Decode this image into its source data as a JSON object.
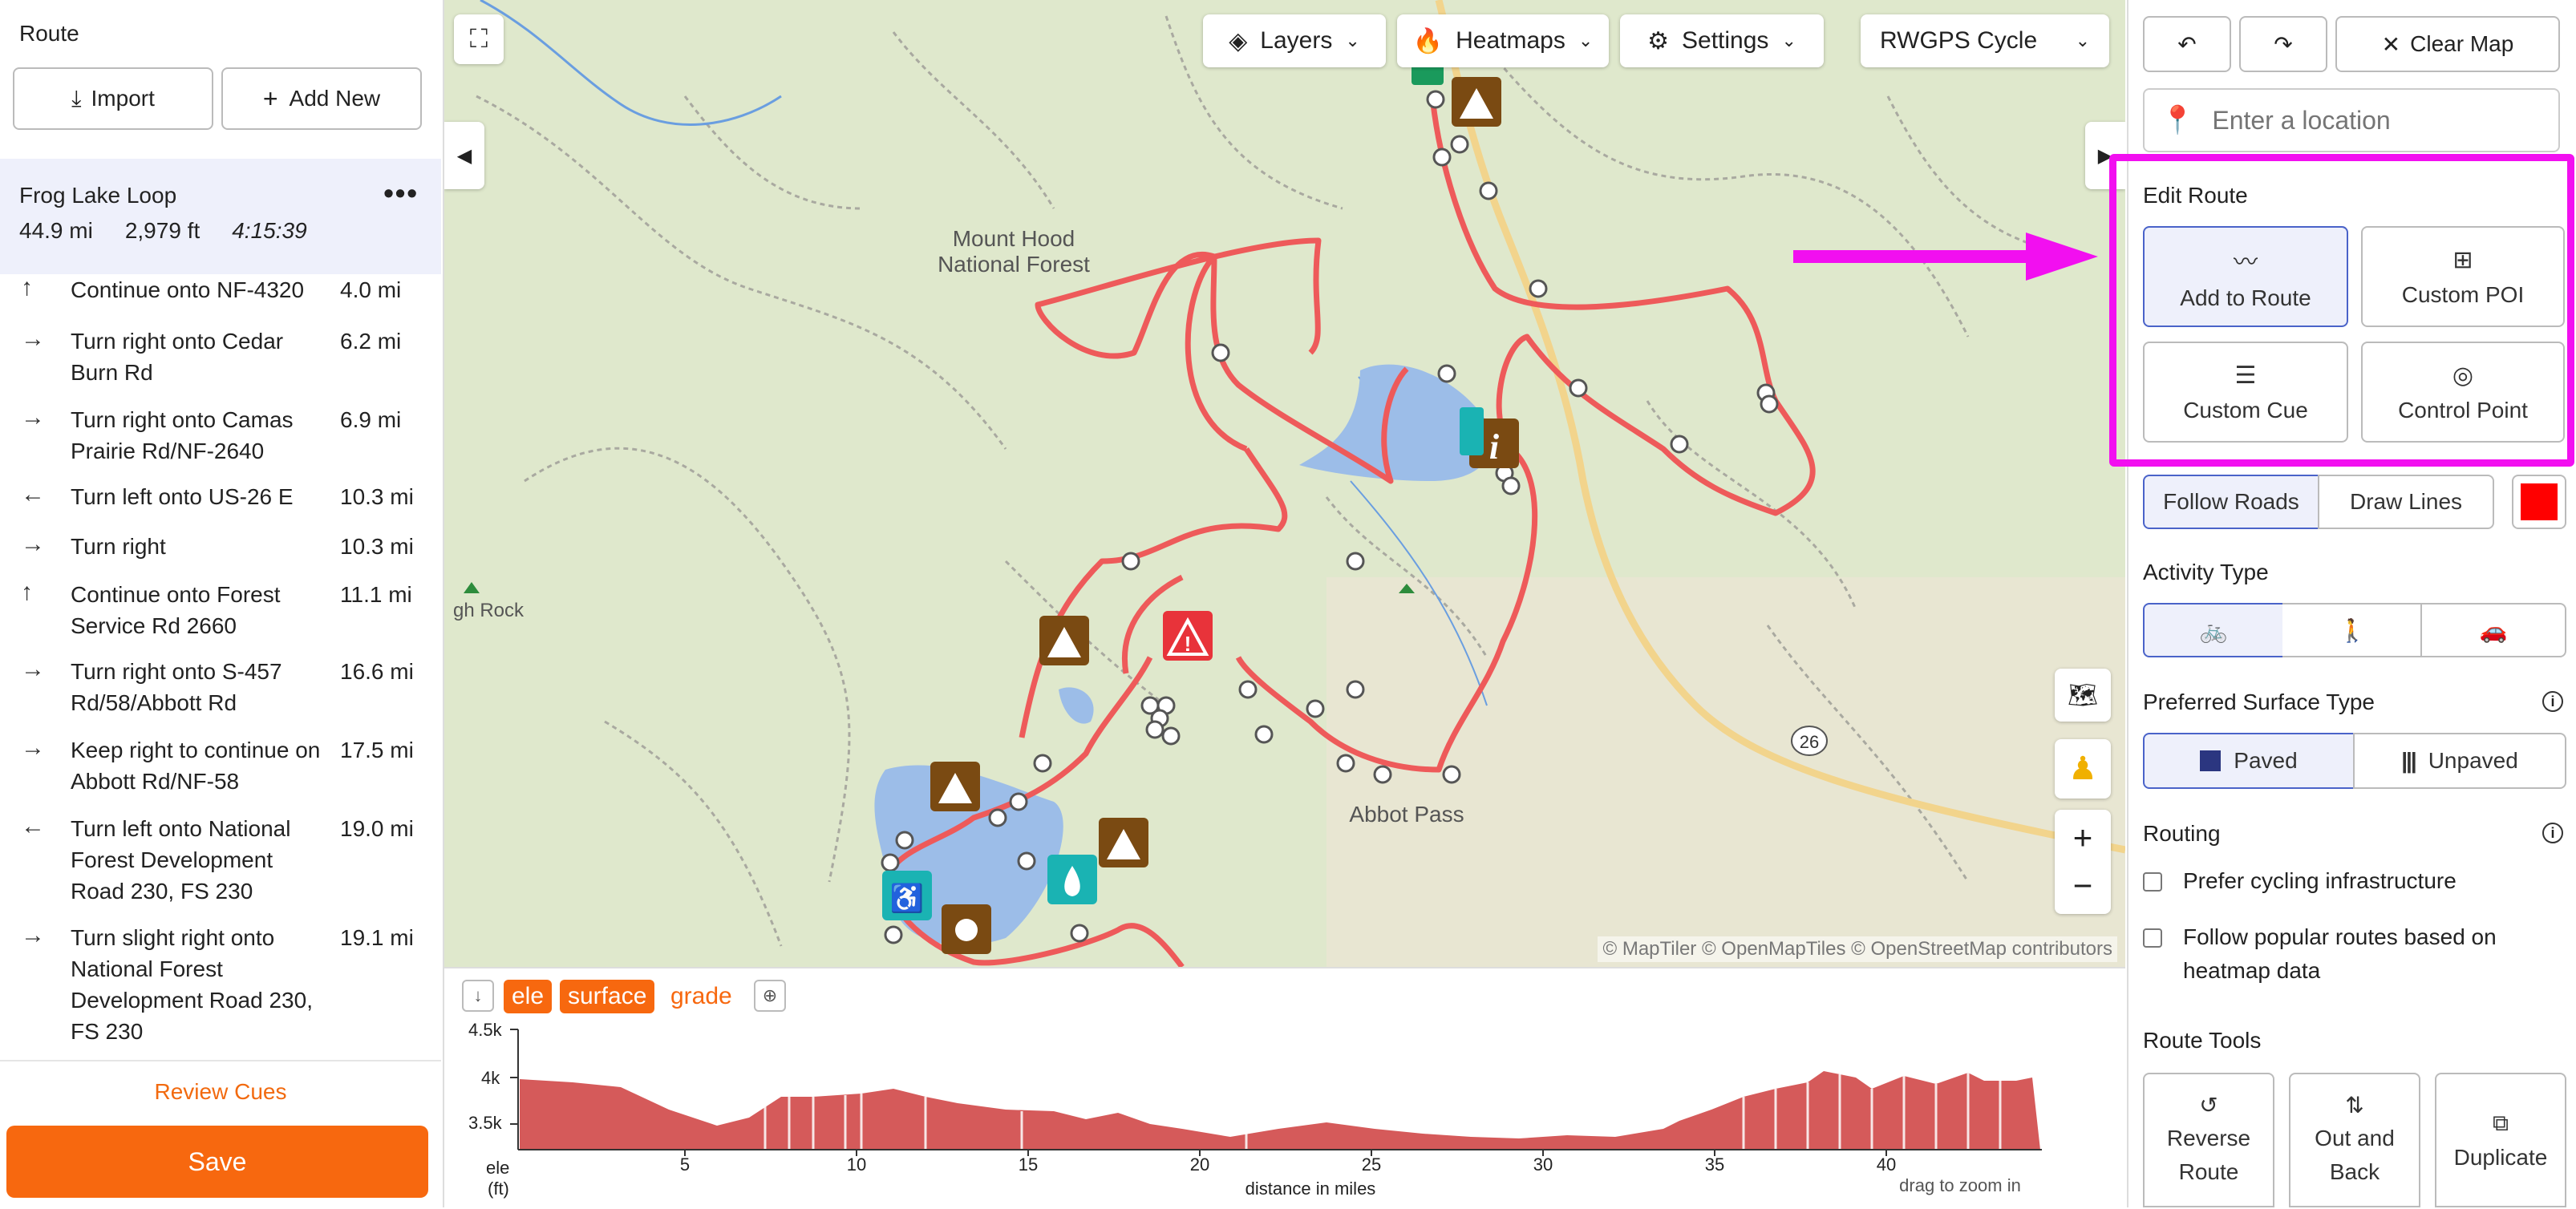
{
  "left": {
    "header": "Route",
    "import_label": "Import",
    "add_new_label": "Add New",
    "route": {
      "name": "Frog Lake Loop",
      "distance": "44.9 mi",
      "elevation": "2,979 ft",
      "time": "4:15:39"
    },
    "cues": [
      {
        "icon": "arrow-up-icon",
        "glyph": "↑",
        "text": "Continue onto NF-4320",
        "dist": "4.0 mi"
      },
      {
        "icon": "arrow-right-icon",
        "glyph": "→",
        "text": "Turn right onto Cedar Burn Rd",
        "dist": "6.2 mi"
      },
      {
        "icon": "arrow-right-icon",
        "glyph": "→",
        "text": "Turn right onto Camas Prairie Rd/NF-2640",
        "dist": "6.9 mi"
      },
      {
        "icon": "arrow-left-icon",
        "glyph": "←",
        "text": "Turn left onto US-26 E",
        "dist": "10.3 mi"
      },
      {
        "icon": "arrow-right-icon",
        "glyph": "→",
        "text": "Turn right",
        "dist": "10.3 mi"
      },
      {
        "icon": "arrow-up-icon",
        "glyph": "↑",
        "text": "Continue onto Forest Service Rd 2660",
        "dist": "11.1 mi"
      },
      {
        "icon": "arrow-right-icon",
        "glyph": "→",
        "text": "Turn right onto S-457 Rd/58/Abbott Rd",
        "dist": "16.6 mi"
      },
      {
        "icon": "arrow-right-icon",
        "glyph": "→",
        "text": "Keep right to continue on Abbott Rd/NF-58",
        "dist": "17.5 mi"
      },
      {
        "icon": "arrow-left-icon",
        "glyph": "←",
        "text": "Turn left onto National Forest Development Road 230, FS 230",
        "dist": "19.0 mi"
      },
      {
        "icon": "arrow-right-icon",
        "glyph": "→",
        "text": "Turn slight right onto National Forest Development Road 230, FS 230",
        "dist": "19.1 mi"
      }
    ],
    "review_label": "Review Cues",
    "save_label": "Save"
  },
  "map": {
    "layers_label": "Layers",
    "heatmaps_label": "Heatmaps",
    "settings_label": "Settings",
    "basemap_label": "RWGPS Cycle",
    "labels": {
      "forest": "Mount Hood\nNational Forest",
      "pass": "Abbot Pass",
      "rock": "gh Rock",
      "road": "26"
    },
    "attribution": "© MapTiler © OpenMapTiles © OpenStreetMap contributors"
  },
  "elevation": {
    "tab_ele": "ele",
    "tab_surface": "surface",
    "tab_grade": "grade",
    "y_ticks": [
      "4.5k",
      "4k",
      "3.5k"
    ],
    "y_unit": "ele",
    "y_unit2": "(ft)",
    "x_ticks": [
      "5",
      "10",
      "15",
      "20",
      "25",
      "30",
      "35",
      "40"
    ],
    "x_label": "distance in miles",
    "hint": "drag to zoom in"
  },
  "right": {
    "clear_map_label": "Clear Map",
    "location_placeholder": "Enter a location",
    "edit_route_title": "Edit Route",
    "add_to_route": "Add to Route",
    "custom_poi": "Custom POI",
    "custom_cue": "Custom Cue",
    "control_point": "Control Point",
    "follow_roads": "Follow Roads",
    "draw_lines": "Draw Lines",
    "route_color": "#ff0000",
    "activity_type_title": "Activity Type",
    "surface_title": "Preferred Surface Type",
    "paved": "Paved",
    "unpaved": "Unpaved",
    "routing_title": "Routing",
    "prefer_cycling": "Prefer cycling infrastructure",
    "follow_popular": "Follow popular routes based on heatmap data",
    "route_tools_title": "Route Tools",
    "reverse_route": "Reverse Route",
    "out_and_back": "Out and Back",
    "duplicate": "Duplicate"
  },
  "colors": {
    "accent": "#f7680f",
    "highlight": "#f20ff0",
    "route_line": "#ee5a5a",
    "selected": "#4a63c9"
  }
}
